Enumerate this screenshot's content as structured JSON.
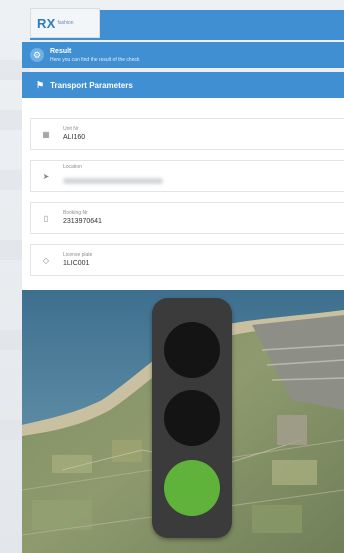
{
  "logo": {
    "brand": "RX",
    "tagline": "fashion"
  },
  "result": {
    "title": "Result",
    "subtitle": "Here you can find the result of the check"
  },
  "panel": {
    "title": "Transport Parameters",
    "fields": [
      {
        "icon": "grid-icon",
        "label": "Unit Nr",
        "value": "ALI160"
      },
      {
        "icon": "location-arrow-icon",
        "label": "Location",
        "value": ""
      },
      {
        "icon": "document-icon",
        "label": "Booking Nr",
        "value": "2313970641"
      },
      {
        "icon": "tag-icon",
        "label": "License plate",
        "value": "1LIC001"
      }
    ]
  },
  "traffic_light": {
    "active": "green",
    "colors": {
      "red_off": "#141414",
      "yellow_off": "#141414",
      "green_on": "#5fb23a",
      "housing": "#3b3b3b"
    }
  },
  "colors": {
    "accent": "#3f8fd2"
  }
}
